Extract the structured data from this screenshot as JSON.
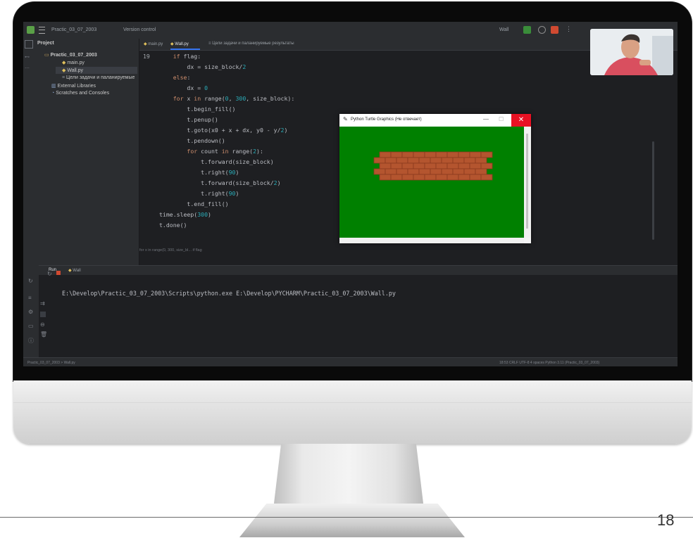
{
  "ide": {
    "project_title": "Practic_03_07_2003",
    "vcs_label": "Version control",
    "run_config": "Wall",
    "project_panel_title": "Project",
    "tree": [
      {
        "label": "Practic_03_07_2003",
        "indent": 0,
        "icon": "folder-icon"
      },
      {
        "label": "main.py",
        "indent": 1,
        "icon": "python-file-icon"
      },
      {
        "label": "Wall.py",
        "indent": 1,
        "icon": "python-file-icon",
        "selected": true
      },
      {
        "label": "Цели задачи и паланируемые",
        "indent": 1,
        "icon": "text-file-icon"
      },
      {
        "label": "External Libraries",
        "indent": 0,
        "icon": "library-icon"
      },
      {
        "label": "Scratches and Consoles",
        "indent": 0,
        "icon": "scratch-icon"
      }
    ],
    "tabs": [
      {
        "label": "main.py",
        "active": false
      },
      {
        "label": "Wall.py",
        "active": true
      },
      {
        "label": "Цели задачи и паланируемые результаты",
        "active": false
      }
    ],
    "first_line_number": "19",
    "code_lines": [
      "    if flag:",
      "        dx = size_block/2",
      "    else:",
      "        dx = 0",
      "    for x in range(0, 300, size_block):",
      "        t.begin_fill()",
      "        t.penup()",
      "        t.goto(x0 + x + dx, y0 - y/2)",
      "        t.pendown()",
      "        for count in range(2):",
      "            t.forward(size_block)",
      "            t.right(90)",
      "            t.forward(size_block/2)",
      "            t.right(90)",
      "        t.end_fill()",
      "time.sleep(300)",
      "t.done()"
    ],
    "breadcrumb": "for x in range(0, 300, size_bl...   if flag",
    "run_tab_label": "Run",
    "run_config_tab": "Wall",
    "run_command": "E:\\Develop\\Practic_03_07_2003\\Scripts\\python.exe E:\\Develop\\PYCHARM\\Practic_03_07_2003\\Wall.py",
    "status_left": "Practic_03_07_2003  >  Wall.py",
    "status_right": "18:53   CRLF   UTF-8   4 spaces   Python 3.11 (Practic_03_07_2003)"
  },
  "turtle_window": {
    "title": "Python Turtle Graphics (Не отвечает)",
    "canvas_color": "#008000",
    "brick_color": "#b4552f",
    "brick_rows": 5
  },
  "page_number": "18"
}
